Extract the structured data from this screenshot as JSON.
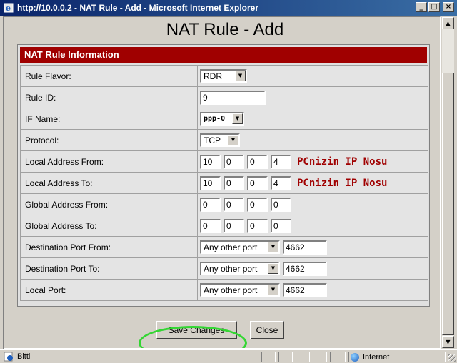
{
  "window": {
    "title": "http://10.0.0.2 - NAT Rule - Add - Microsoft Internet Explorer",
    "min_glyph": "_",
    "max_glyph": "□",
    "close_glyph": "×"
  },
  "page": {
    "heading": "NAT Rule - Add",
    "section_title": "NAT Rule Information"
  },
  "rows": {
    "rule_flavor": {
      "label": "Rule Flavor:",
      "value": "RDR"
    },
    "rule_id": {
      "label": "Rule ID:",
      "value": "9"
    },
    "if_name": {
      "label": "IF Name:",
      "value": "ppp-0"
    },
    "protocol": {
      "label": "Protocol:",
      "value": "TCP"
    },
    "local_from": {
      "label": "Local Address From:",
      "octets": [
        "10",
        "0",
        "0",
        "4"
      ],
      "note": "PCnizin IP Nosu"
    },
    "local_to": {
      "label": "Local Address To:",
      "octets": [
        "10",
        "0",
        "0",
        "4"
      ],
      "note": "PCnizin IP Nosu"
    },
    "global_from": {
      "label": "Global Address From:",
      "octets": [
        "0",
        "0",
        "0",
        "0"
      ]
    },
    "global_to": {
      "label": "Global Address To:",
      "octets": [
        "0",
        "0",
        "0",
        "0"
      ]
    },
    "dest_port_from": {
      "label": "Destination Port From:",
      "select": "Any other port",
      "port": "4662"
    },
    "dest_port_to": {
      "label": "Destination Port To:",
      "select": "Any other port",
      "port": "4662"
    },
    "local_port": {
      "label": "Local Port:",
      "select": "Any other port",
      "port": "4662"
    }
  },
  "buttons": {
    "save": "Save Changes",
    "close": "Close"
  },
  "statusbar": {
    "text": "Bitti",
    "zone": "Internet"
  },
  "colors": {
    "section_header": "#a00000",
    "note_text": "#a00000",
    "highlight_circle": "#33d633",
    "titlebar": "#0a246a"
  }
}
